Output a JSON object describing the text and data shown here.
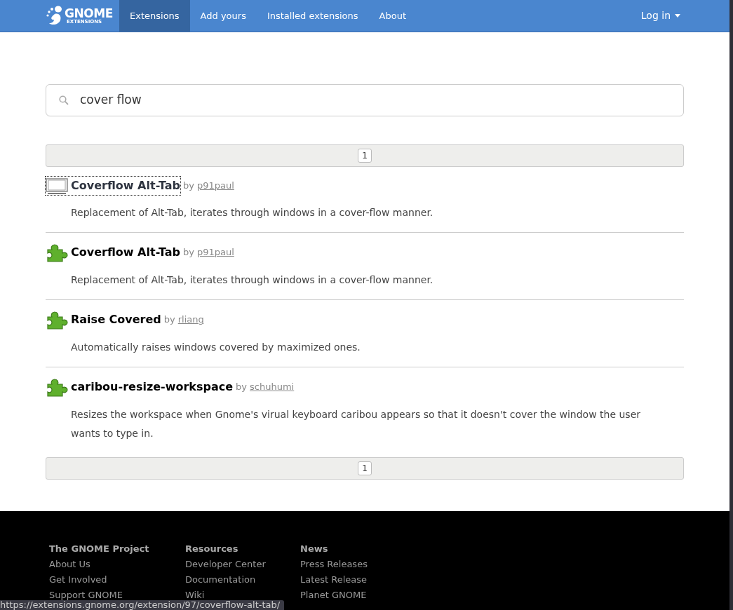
{
  "nav": {
    "logo": {
      "word": "GNOME",
      "sub": "EXTENSIONS"
    },
    "items": [
      {
        "label": "Extensions",
        "selected": true
      },
      {
        "label": "Add yours",
        "selected": false
      },
      {
        "label": "Installed extensions",
        "selected": false
      },
      {
        "label": "About",
        "selected": false
      }
    ],
    "login": "Log in"
  },
  "search": {
    "value": "cover flow"
  },
  "pagination_top": [
    {
      "label": "1"
    }
  ],
  "results": [
    {
      "kind": "broken",
      "focused": true,
      "name": "Coverflow Alt-Tab",
      "by": "by",
      "author": "p91paul",
      "description": "Replacement of Alt-Tab, iterates through windows in a cover-flow manner."
    },
    {
      "kind": "puzzle",
      "focused": false,
      "name": "Coverflow Alt-Tab",
      "by": "by",
      "author": "p91paul",
      "description": "Replacement of Alt-Tab, iterates through windows in a cover-flow manner."
    },
    {
      "kind": "puzzle",
      "focused": false,
      "name": "Raise Covered",
      "by": "by",
      "author": "rliang",
      "description": "Automatically raises windows covered by maximized ones."
    },
    {
      "kind": "puzzle",
      "focused": false,
      "name": "caribou-resize-workspace",
      "by": "by",
      "author": "schuhumi",
      "description": "Resizes the workspace when Gnome's virual keyboard caribou appears so that it doesn't cover the window the user wants to type in."
    }
  ],
  "pagination_bottom": [
    {
      "label": "1"
    }
  ],
  "footer": {
    "columns": [
      {
        "heading": "The GNOME Project",
        "links": [
          "About Us",
          "Get Involved",
          "Support GNOME"
        ]
      },
      {
        "heading": "Resources",
        "links": [
          "Developer Center",
          "Documentation",
          "Wiki"
        ]
      },
      {
        "heading": "News",
        "links": [
          "Press Releases",
          "Latest Release",
          "Planet GNOME"
        ]
      }
    ]
  },
  "status_bar": {
    "url": "https://extensions.gnome.org/extension/97/coverflow-alt-tab/"
  }
}
